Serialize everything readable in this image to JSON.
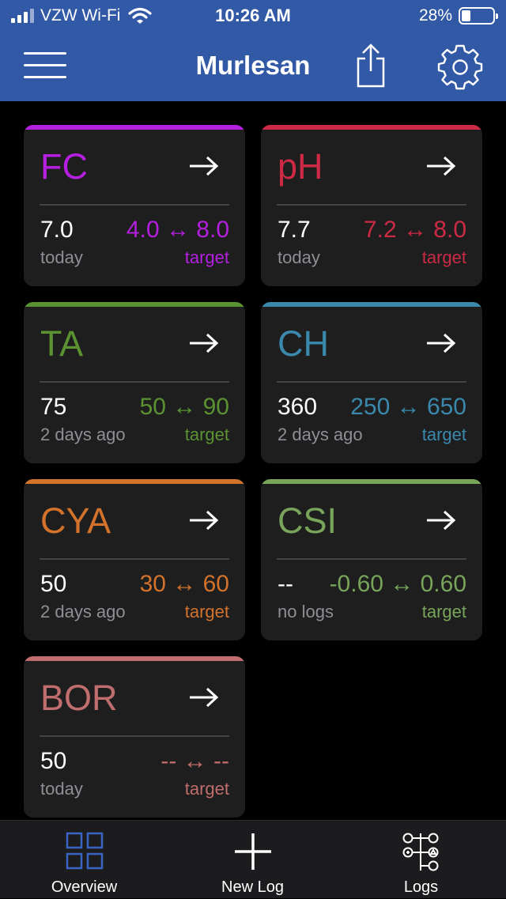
{
  "status": {
    "carrier": "VZW Wi-Fi",
    "time": "10:26 AM",
    "battery": "28%",
    "battery_level": 0.28
  },
  "nav": {
    "title": "Murlesan"
  },
  "cards": [
    {
      "name": "FC",
      "value": "7.0",
      "when": "today",
      "target": "4.0 ↔ 8.0",
      "target_label": "target",
      "color": "#b51fe0"
    },
    {
      "name": "pH",
      "value": "7.7",
      "when": "today",
      "target": "7.2 ↔ 8.0",
      "target_label": "target",
      "color": "#cc2a45"
    },
    {
      "name": "TA",
      "value": "75",
      "when": "2 days ago",
      "target": "50 ↔ 90",
      "target_label": "target",
      "color": "#5b9232"
    },
    {
      "name": "CH",
      "value": "360",
      "when": "2 days ago",
      "target": "250 ↔ 650",
      "target_label": "target",
      "color": "#3a89ad"
    },
    {
      "name": "CYA",
      "value": "50",
      "when": "2 days ago",
      "target": "30 ↔ 60",
      "target_label": "target",
      "color": "#d2722b"
    },
    {
      "name": "CSI",
      "value": "--",
      "when": "no logs",
      "target": "-0.60 ↔ 0.60",
      "target_label": "target",
      "color": "#78a55a"
    },
    {
      "name": "BOR",
      "value": "50",
      "when": "today",
      "target": "-- ↔ --",
      "target_label": "target",
      "color": "#c06d6d"
    }
  ],
  "tabs": [
    {
      "label": "Overview",
      "icon": "grid-icon",
      "active": true
    },
    {
      "label": "New Log",
      "icon": "plus-icon"
    },
    {
      "label": "Logs",
      "icon": "logs-icon"
    }
  ],
  "colors": {
    "header": "#3259a5",
    "active_tab": "#3a64c4"
  }
}
